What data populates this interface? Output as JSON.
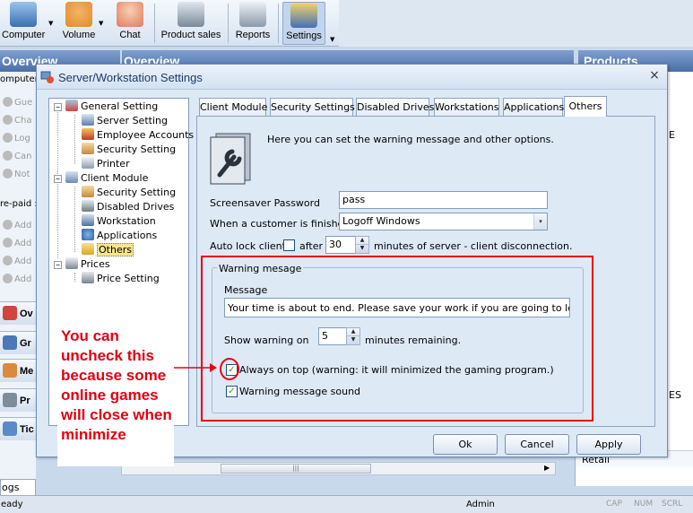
{
  "toolbar": {
    "items": [
      {
        "label": "Computer",
        "icon": "computer-icon",
        "color": "#3a6fb0"
      },
      {
        "label": "Volume",
        "icon": "headset-icon",
        "color": "#e08a2c"
      },
      {
        "label": "Chat",
        "icon": "chat-person-icon",
        "color": "#e07a60"
      },
      {
        "label": "Product sales",
        "icon": "shopping-cart-icon",
        "color": "#7a8a99"
      },
      {
        "label": "Reports",
        "icon": "printer-icon",
        "color": "#8a9aab"
      },
      {
        "label": "Settings",
        "icon": "settings-icon",
        "color": "#4470b5"
      }
    ]
  },
  "background": {
    "left_header": "Overview",
    "center_header": "Overview",
    "right_header": "Products",
    "left_subheader": "omputer",
    "left_items": [
      "Gue",
      "Cha",
      "Log",
      "Can",
      "Not"
    ],
    "prepaid_label": "re-paid :",
    "prepaid_items": [
      "Add",
      "Add",
      "Add",
      "Add"
    ],
    "nav_buttons": [
      "Ov",
      "Gr",
      "Me",
      "Pr",
      "Tic"
    ],
    "right_items": [
      "E",
      "ES"
    ],
    "right_bottom": "Retail",
    "bottom_tab": "ogs",
    "status_left": "eady",
    "status_user": "Admin",
    "status_keys": [
      "CAP",
      "NUM",
      "SCRL"
    ]
  },
  "dialog": {
    "title": "Server/Workstation Settings",
    "close": "×",
    "tree": [
      {
        "label": "General Setting",
        "level": 0,
        "icon": "general-setting-icon"
      },
      {
        "label": "Server Setting",
        "level": 1,
        "icon": "server-icon"
      },
      {
        "label": "Employee Accounts",
        "level": 1,
        "icon": "employee-accounts-icon"
      },
      {
        "label": "Security Setting",
        "level": 1,
        "icon": "security-icon"
      },
      {
        "label": "Printer",
        "level": 1,
        "icon": "printer-icon"
      },
      {
        "label": "Client Module",
        "level": 0,
        "icon": "client-module-icon"
      },
      {
        "label": "Security Setting",
        "level": 1,
        "icon": "security-icon"
      },
      {
        "label": "Disabled Drives",
        "level": 1,
        "icon": "drive-icon"
      },
      {
        "label": "Workstation",
        "level": 1,
        "icon": "workstation-icon"
      },
      {
        "label": "Applications",
        "level": 1,
        "icon": "applications-icon"
      },
      {
        "label": "Others",
        "level": 1,
        "icon": "others-icon",
        "selected": true
      },
      {
        "label": "Prices",
        "level": 0,
        "icon": "prices-icon"
      },
      {
        "label": "Price Setting",
        "level": 1,
        "icon": "price-tag-icon"
      }
    ],
    "toggle_minus": "−",
    "tabs": [
      "Client Module",
      "Security Settings",
      "Disabled Drives",
      "Workstations",
      "Applications",
      "Others"
    ],
    "active_tab": "Others",
    "intro": "Here you can set the warning message and other options.",
    "screensaver_label": "Screensaver Password",
    "screensaver_value": "pass",
    "finished_label": "When a customer is finished :",
    "finished_value": "Logoff Windows",
    "autolock_label": "Auto lock client",
    "autolock_after": "after",
    "autolock_value": "30",
    "autolock_suffix": "minutes of server - client disconnection.",
    "group_title": "Warning mesage",
    "message_label": "Message",
    "message_value": "Your time is about to end. Please save your work if you are going to leave. Oth",
    "show_warning_label": "Show warning on",
    "show_warning_value": "5",
    "show_warning_suffix": "minutes remaining.",
    "always_on_top_label": "Always on top (warning: it will minimized the gaming program.)",
    "always_on_top_checked": true,
    "sound_label": "Warning message sound",
    "sound_checked": true,
    "ok": "Ok",
    "cancel": "Cancel",
    "apply": "Apply"
  },
  "annotation": {
    "text": "You can uncheck this because some online games will close when minimize",
    "color": "#e8000f"
  },
  "glyphs": {
    "check": "✓",
    "up": "▲",
    "down": "▼",
    "drop": "▼",
    "dropsmall": "▾",
    "scroll_right": "▶",
    "scroll_grip": "|||"
  }
}
